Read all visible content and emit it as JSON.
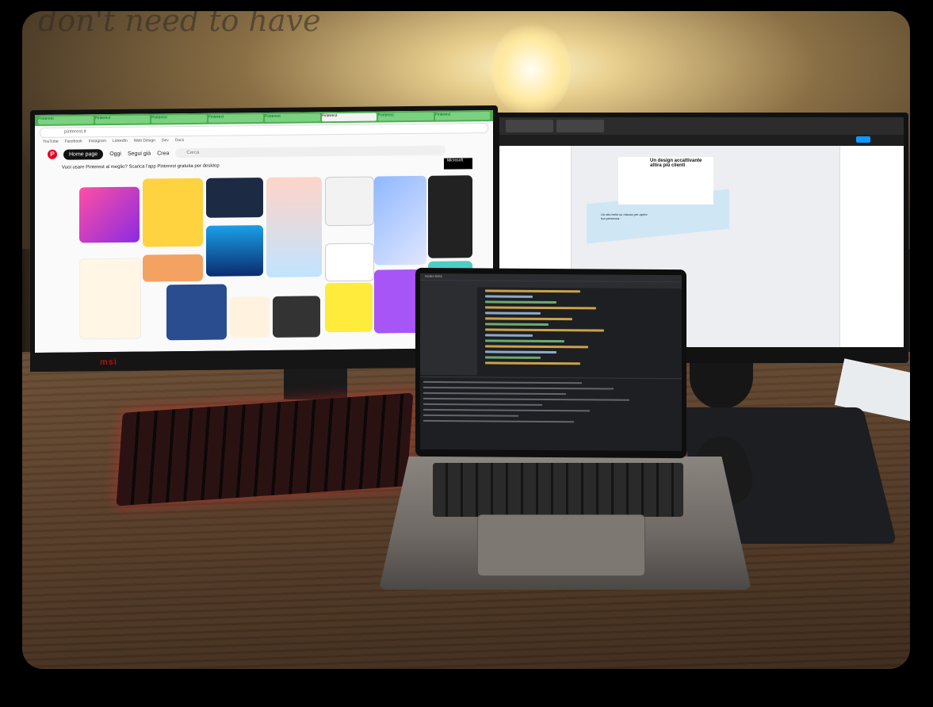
{
  "scene": {
    "wall_text": "don't need to have",
    "left_monitor": {
      "brand": "msi",
      "browser": {
        "tabs": [
          "Pinterest",
          "Pinterest",
          "Pinterest",
          "Pinterest",
          "Pinterest",
          "Pinterest",
          "Pinterest",
          "Pinterest"
        ],
        "url": "pinterest.it",
        "bookmarks": [
          "YouTube",
          "Facebook",
          "Instagram",
          "LinkedIn",
          "Web Design",
          "Dev",
          "Docs"
        ],
        "pinterest": {
          "home_button": "Home page",
          "today": "Oggi",
          "following": "Segui già",
          "create": "Crea",
          "search_placeholder": "Cerca",
          "banner": "Vuoi usare Pinterest al meglio? Scarica l'app Pinterest gratuita per desktop",
          "microsoft_badge": "Microsoft"
        }
      }
    },
    "right_monitor": {
      "app": "Figma",
      "canvas_heading": "Un design accattivante attira più clienti",
      "strip_heading": "Un sito bello su misura per aprire tua presenza."
    },
    "laptop": {
      "app": "IntelliJ IDEA"
    },
    "colors": {
      "pinterest_red": "#e60023",
      "chrome_green": "#4caf50",
      "keyboard_glow": "#dc2828",
      "figma_blue": "#0d99ff"
    }
  }
}
